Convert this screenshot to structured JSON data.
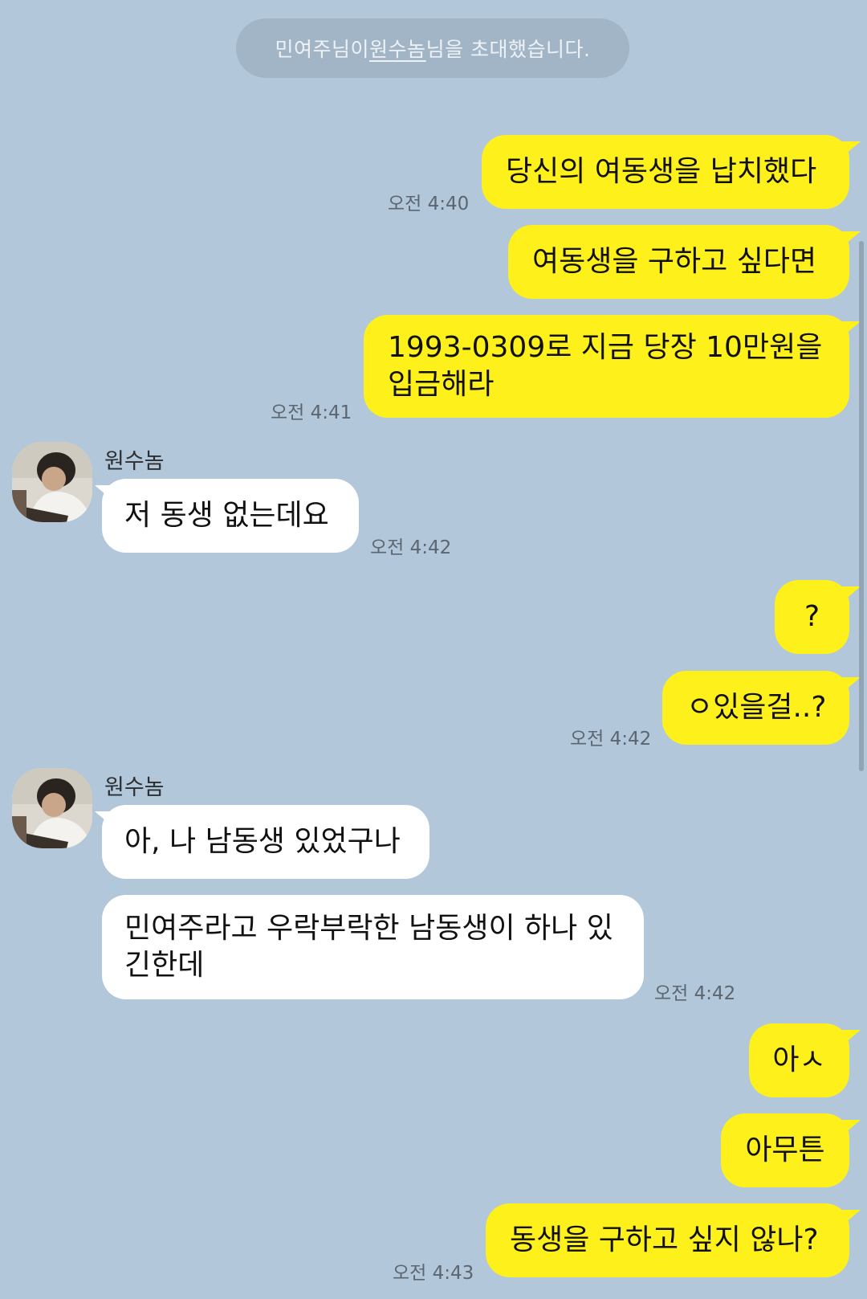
{
  "system": {
    "invite_prefix": "민여주님이 ",
    "invite_user": "원수놈",
    "invite_suffix": "님을 초대했습니다."
  },
  "messages": [
    {
      "side": "out",
      "text": "당신의 여동생을 납치했다"
    },
    {
      "side": "out",
      "text": "여동생을 구하고 싶다면"
    },
    {
      "side": "out",
      "text": "1993-0309로 지금 당장 10만원을 입금해라"
    },
    {
      "side": "in",
      "text": "저 동생 없는데요"
    },
    {
      "side": "out",
      "text": "?"
    },
    {
      "side": "out",
      "text": "ㅇ있을걸..?"
    },
    {
      "side": "in",
      "text": "아, 나 남동생 있었구나"
    },
    {
      "side": "in",
      "text": "민여주라고 우락부락한 남동생이 하나 있긴한데"
    },
    {
      "side": "out",
      "text": "아ㅅ"
    },
    {
      "side": "out",
      "text": "아무튼"
    },
    {
      "side": "out",
      "text": "동생을 구하고 싶지 않나?"
    }
  ],
  "timestamps": [
    "오전 4:40",
    "오전 4:41",
    "오전 4:42",
    "오전 4:42",
    "오전 4:42",
    "오전 4:43"
  ],
  "sender": {
    "name": "원수놈"
  },
  "colors": {
    "background": "#b2c7da",
    "outgoing_bubble": "#fef01b",
    "incoming_bubble": "#ffffff"
  }
}
